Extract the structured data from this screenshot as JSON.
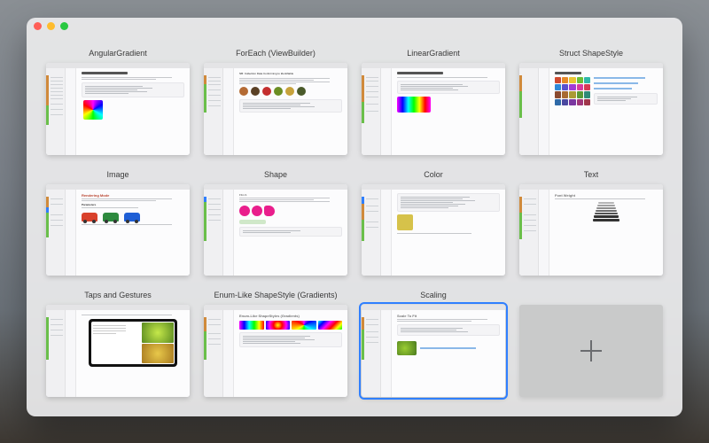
{
  "tabs": [
    {
      "title": "AngularGradient",
      "kind": "angular"
    },
    {
      "title": "ForEach (ViewBuilder)",
      "kind": "foreach"
    },
    {
      "title": "LinearGradient",
      "kind": "linear"
    },
    {
      "title": "Struct ShapeStyle",
      "kind": "shapestyle"
    },
    {
      "title": "Image",
      "kind": "image"
    },
    {
      "title": "Shape",
      "kind": "shape"
    },
    {
      "title": "Color",
      "kind": "color"
    },
    {
      "title": "Text",
      "kind": "text"
    },
    {
      "title": "Taps and Gestures",
      "kind": "taps"
    },
    {
      "title": "Enum-Like ShapeStyle (Gradients)",
      "kind": "enumlike"
    },
    {
      "title": "Scaling",
      "kind": "scaling",
      "selected": true
    }
  ],
  "headings": {
    "angular": "AngularGradient",
    "foreach_heading": "ForEach (ViewBuilder)",
    "foreach_sub": "NB: Collection Data Conforming to Identifiable",
    "linear": "LinearGradient",
    "linear_sub": "NB: Unit radius preferred.",
    "shapestyle": "Struct ShapeStyle",
    "image": "Image",
    "image_section": "Rendering Mode",
    "image_paramlabel": "Parameters",
    "shape": "Shape",
    "shape_section": "FILLS",
    "color": "Color",
    "text": "Text",
    "text_section": "Font Weight",
    "taps": "Taps and Gestures",
    "enumlike_heading": "Enum-Like ShapeStyle (Gradients)",
    "enumlike_sub": "Enum-Like ShapeStyles (Gradients)",
    "scaling": "Scaling",
    "scaling_section": "Scale To Fit"
  },
  "colors": {
    "foreach_circles": [
      "#b46b34",
      "#5a4025",
      "#c42f2f",
      "#6b8e23",
      "#c7a23b",
      "#4a5a2a"
    ],
    "image_cars": [
      "#d9412b",
      "#2d8a3e",
      "#1f5fd6"
    ],
    "shapestyle_swatches": [
      "#d04a2f",
      "#e58a2a",
      "#e8c534",
      "#6bbf35",
      "#2fb8a8",
      "#2f88d6",
      "#5a52d0",
      "#a03ad6",
      "#d63a9e",
      "#d63a55",
      "#8a4a30",
      "#a86a32",
      "#aa9a34",
      "#5a9a35",
      "#2f8a78",
      "#2f6aa8",
      "#4a48a0",
      "#7a36a0",
      "#a0367a",
      "#a0364a"
    ],
    "color_swatch": "#d6c24a",
    "enumlike_gradients": [
      "linear-gradient(90deg,#f0f,#00f,#0ff,#0f0,#ff0,#f00)",
      "radial-gradient(circle,#ff0,#f00,#f0f,#00f)",
      "conic-gradient(#f0f,#00f,#0ff,#0f0,#ff0,#f00,#f0f)",
      "linear-gradient(135deg,#0ff,#00f,#f0f,#f00,#ff0,#0f0)"
    ],
    "ipad_fruits": [
      "#9acd32",
      "#d6b23a"
    ]
  },
  "traffic_colors": [
    "#ff5f57",
    "#febc2e",
    "#28c840"
  ]
}
